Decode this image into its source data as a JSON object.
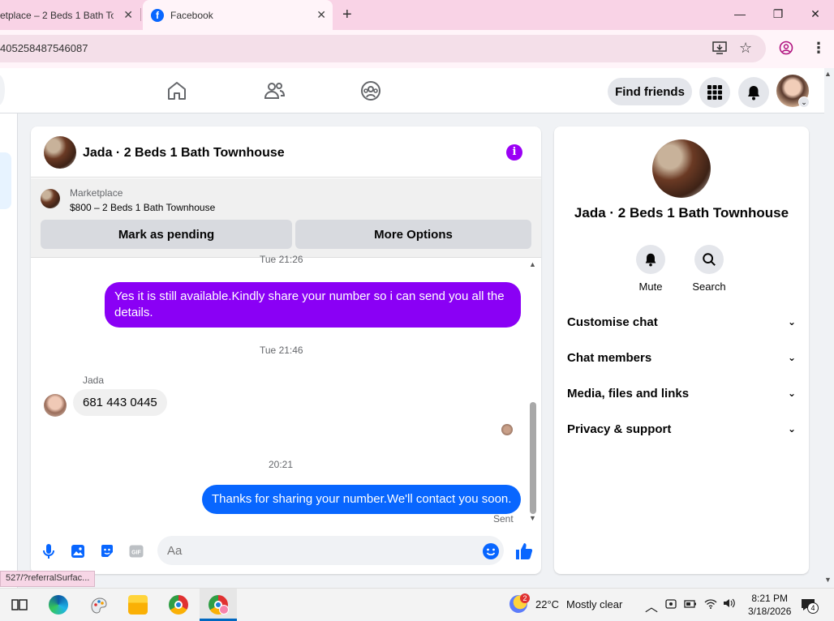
{
  "browser": {
    "tabs": [
      {
        "title": "etplace – 2 Beds 1 Bath To",
        "close": "✕"
      },
      {
        "title": "Facebook",
        "close": "✕"
      }
    ],
    "new_tab": "+",
    "url": "405258487546087",
    "window": {
      "minimize": "—",
      "restore": "❐",
      "close": "✕"
    }
  },
  "fbnav": {
    "find_friends": "Find friends",
    "icons": [
      "home-icon",
      "friends-icon",
      "groups-icon",
      "menu-grid-icon",
      "notifications-icon"
    ]
  },
  "chat": {
    "title": "Jada · 2 Beds 1 Bath Townhouse",
    "info_glyph": "i",
    "marketplace": {
      "label": "Marketplace",
      "listing": "$800 – 2 Beds 1 Bath Townhouse",
      "mark_pending": "Mark as pending",
      "more_options": "More Options"
    },
    "messages": [
      {
        "type": "timestamp",
        "text": "Tue 21:26"
      },
      {
        "type": "outgoing",
        "text": "Yes it is still available.Kindly share your number so i can send you all the details."
      },
      {
        "type": "timestamp",
        "text": "Tue 21:46"
      },
      {
        "type": "incoming",
        "sender": "Jada",
        "text": "681 443 0445"
      },
      {
        "type": "timestamp",
        "text": "20:21"
      },
      {
        "type": "outgoing",
        "text": "Thanks for sharing your number.We'll contact you soon.",
        "status": "Sent"
      }
    ],
    "composer_placeholder": "Aa"
  },
  "side": {
    "title": "Jada · 2 Beds 1 Bath Townhouse",
    "actions": [
      {
        "label": "Mute"
      },
      {
        "label": "Search"
      }
    ],
    "sections": [
      {
        "label": "Customise chat"
      },
      {
        "label": "Chat members"
      },
      {
        "label": "Media, files and links"
      },
      {
        "label": "Privacy & support"
      }
    ]
  },
  "status_url": "527/?referralSurfac...",
  "taskbar": {
    "weather_temp": "22°C",
    "weather_desc": "Mostly clear",
    "weather_badge": "2",
    "time": "8:21 PM",
    "date": "3/18/2026",
    "notif_count": "4"
  },
  "colors": {
    "outgoing_purple": "#8a00f5",
    "outgoing_blue": "#0866ff",
    "fb_blue": "#0866ff",
    "tab_pink": "#f9d3e6"
  }
}
